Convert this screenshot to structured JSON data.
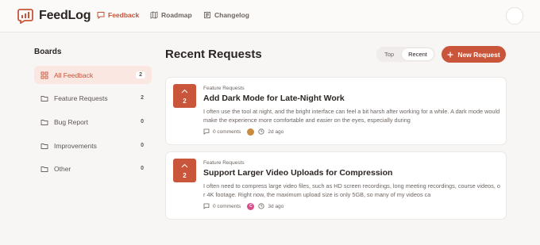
{
  "app": {
    "brand": "FeedLog",
    "brand_color": "#c9553b"
  },
  "nav": [
    {
      "label": "Feedback",
      "icon": "message-square-icon",
      "active": true
    },
    {
      "label": "Roadmap",
      "icon": "map-icon",
      "active": false
    },
    {
      "label": "Changelog",
      "icon": "newspaper-icon",
      "active": false
    }
  ],
  "sidebar": {
    "title": "Boards",
    "items": [
      {
        "label": "All Feedback",
        "count": "2",
        "icon": "grid-icon",
        "active": true
      },
      {
        "label": "Feature Requests",
        "count": "2",
        "icon": "folder-icon",
        "active": false
      },
      {
        "label": "Bug Report",
        "count": "0",
        "icon": "folder-icon",
        "active": false
      },
      {
        "label": "Improvements",
        "count": "0",
        "icon": "folder-icon",
        "active": false
      },
      {
        "label": "Other",
        "count": "0",
        "icon": "folder-icon",
        "active": false
      }
    ]
  },
  "main": {
    "title": "Recent Requests",
    "sort": {
      "options": [
        "Top",
        "Recent"
      ],
      "selected": "Recent"
    },
    "new_button_label": "New Request",
    "requests": [
      {
        "votes": "2",
        "board": "Feature Requests",
        "title": "Add Dark Mode for Late-Night Work",
        "description": "I often use the tool at night, and the bright interface can feel a bit harsh after working for a while. A dark mode would make the experience more comfortable and easier on the eyes, especially during",
        "comments": "0 comments",
        "time": "2d ago",
        "avatar_initial": ""
      },
      {
        "votes": "2",
        "board": "Feature Requests",
        "title": "Support Larger Video Uploads for Compression",
        "description": "I often need to compress large video files, such as HD screen recordings, long meeting recordings, course videos, or 4K footage. Right now, the maximum upload size is only 5GB, so many of my videos ca",
        "comments": "0 comments",
        "time": "3d ago",
        "avatar_initial": "C"
      }
    ]
  }
}
